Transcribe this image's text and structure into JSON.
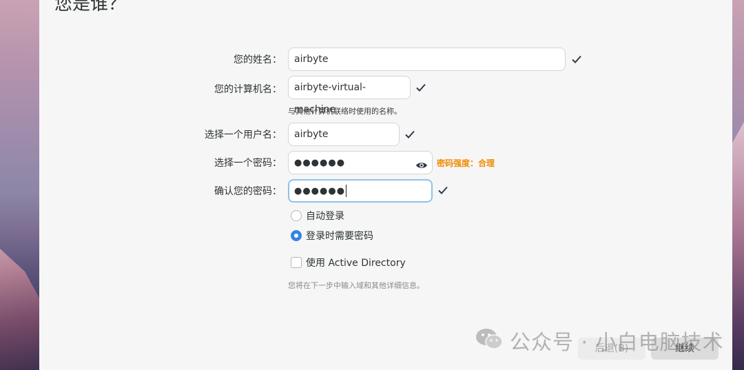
{
  "page": {
    "title": "您是谁？"
  },
  "form": {
    "name": {
      "label": "您的姓名：",
      "value": "airbyte"
    },
    "computer": {
      "label": "您的计算机名：",
      "value": "airbyte-virtual-machine",
      "hint": "与其他计算机联络时使用的名称。"
    },
    "username": {
      "label": "选择一个用户名：",
      "value": "airbyte"
    },
    "password": {
      "label": "选择一个密码：",
      "value": "●●●●●●",
      "strength": "密码强度：合理"
    },
    "confirm": {
      "label": "确认您的密码：",
      "value": "●●●●●●"
    },
    "login_options": [
      {
        "label": "自动登录",
        "selected": false
      },
      {
        "label": "登录时需要密码",
        "selected": true
      }
    ],
    "active_directory": {
      "label": "使用 Active Directory",
      "checked": false
    },
    "note": "您将在下一步中输入域和其他详细信息。"
  },
  "buttons": {
    "back": "后退(B)",
    "next": "继续"
  },
  "watermark": {
    "text": "公众号 · 小白电脑技术"
  },
  "colors": {
    "accent": "#3584e4",
    "strength": "#f08c00",
    "focus_border": "#8fc1e8"
  },
  "icons": {
    "check": "check-icon",
    "eye": "eye-icon",
    "wechat": "wechat-icon"
  }
}
